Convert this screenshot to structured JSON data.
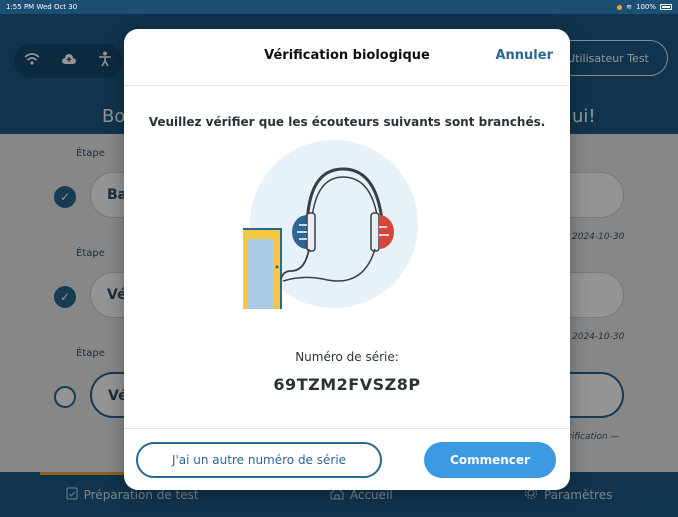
{
  "status_bar": {
    "time": "1:55 PM",
    "date": "Wed Oct 30",
    "battery": "100%"
  },
  "header": {
    "user_button_label": "Utilisateur Test",
    "welcome_left": "Bo",
    "welcome_right": "ui!"
  },
  "steps": [
    {
      "label": "Étape",
      "box_text": "Ba",
      "date": "2024-10-30",
      "completed": true
    },
    {
      "label": "Étape",
      "box_text": "Vé",
      "date": "2024-10-30",
      "completed": true
    },
    {
      "label": "Étape",
      "box_text": "Vé",
      "date": "rification —",
      "completed": false
    }
  ],
  "bottom_nav": {
    "item_1": "Préparation de test",
    "item_2": "Accueil",
    "item_3": "Paramètres"
  },
  "modal": {
    "title": "Vérification biologique",
    "cancel_label": "Annuler",
    "instruction": "Veuillez vérifier que les écouteurs suivants sont branchés.",
    "serial_label": "Numéro de série:",
    "serial_value": "69TZM2FVSZ8P",
    "other_serial_button": "J'ai un autre numéro de série",
    "start_button": "Commencer"
  },
  "colors": {
    "brand_blue": "#1c5b86",
    "accent_blue": "#2a6792",
    "primary_button": "#3b9ae1",
    "accent_orange": "#f1a33b",
    "headphone_left": "#2a6792",
    "headphone_right": "#d8453b"
  },
  "icons": {
    "wifi": "wifi-icon",
    "cloud_upload": "cloud-upload-icon",
    "person_tree": "accessibility-icon",
    "check": "check-icon",
    "clipboard": "clipboard-icon",
    "home": "home-icon",
    "gear": "gear-icon"
  }
}
